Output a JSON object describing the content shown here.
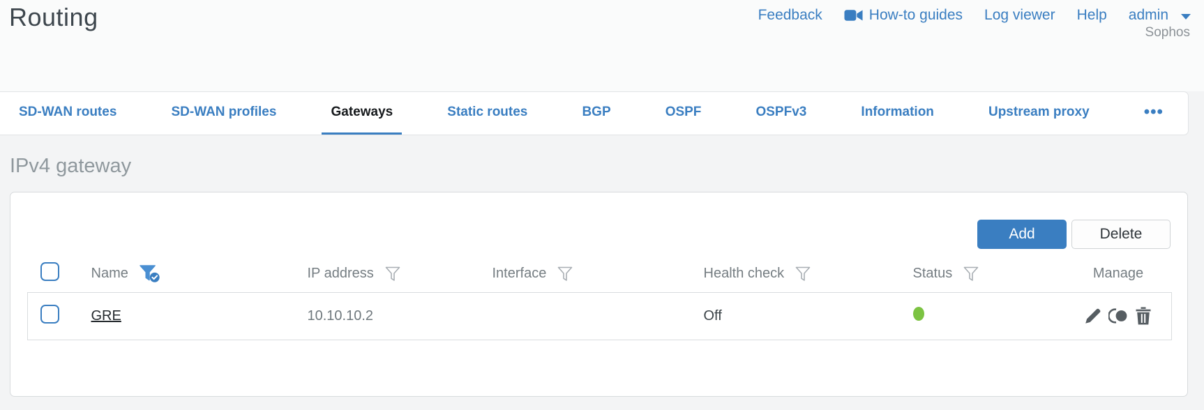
{
  "page": {
    "title": "Routing",
    "brand": "Sophos"
  },
  "header_links": {
    "feedback": "Feedback",
    "how_to_guides": "How-to guides",
    "log_viewer": "Log viewer",
    "help": "Help",
    "user": "admin"
  },
  "tabs": [
    {
      "label": "SD-WAN routes",
      "active": false
    },
    {
      "label": "SD-WAN profiles",
      "active": false
    },
    {
      "label": "Gateways",
      "active": true
    },
    {
      "label": "Static routes",
      "active": false
    },
    {
      "label": "BGP",
      "active": false
    },
    {
      "label": "OSPF",
      "active": false
    },
    {
      "label": "OSPFv3",
      "active": false
    },
    {
      "label": "Information",
      "active": false
    },
    {
      "label": "Upstream proxy",
      "active": false
    },
    {
      "label": "•••",
      "active": false
    }
  ],
  "section": {
    "title": "IPv4 gateway"
  },
  "toolbar": {
    "add_label": "Add",
    "delete_label": "Delete"
  },
  "table": {
    "columns": [
      {
        "label": "Name",
        "filter": "active"
      },
      {
        "label": "IP address",
        "filter": "inactive"
      },
      {
        "label": "Interface",
        "filter": "inactive"
      },
      {
        "label": "Health check",
        "filter": "inactive"
      },
      {
        "label": "Status",
        "filter": "inactive"
      },
      {
        "label": "Manage",
        "filter": "none"
      }
    ],
    "rows": [
      {
        "name": "GRE",
        "ip_address": "10.10.10.2",
        "interface": "",
        "health_check": "Off",
        "status": "up",
        "manage": [
          "edit",
          "clone",
          "delete"
        ]
      }
    ]
  },
  "icons": [
    "video-camera-icon",
    "caret-down-icon",
    "filter-active-icon",
    "filter-icon",
    "edit-icon",
    "clone-icon",
    "delete-icon",
    "more-tabs-icon"
  ],
  "colors": {
    "accent": "#3a7ec1",
    "green": "#7cc342",
    "icon": "#565d62"
  }
}
